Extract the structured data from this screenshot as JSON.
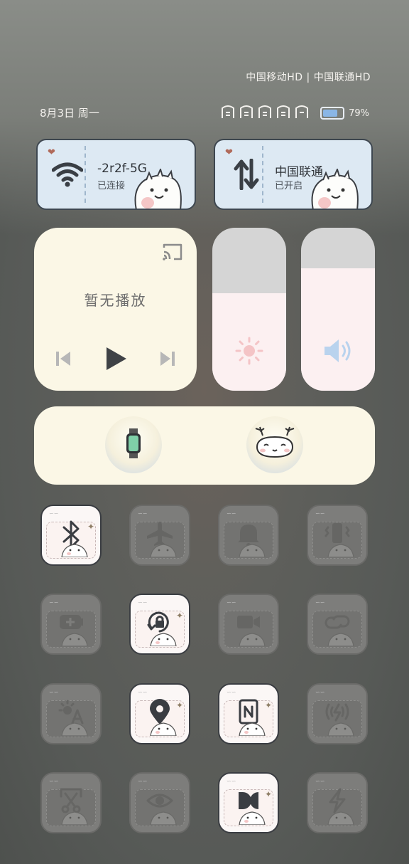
{
  "status": {
    "carriers": "中国移动HD | 中国联通HD",
    "date": "8月3日 周一",
    "battery": "79%",
    "battery_level": 0.79
  },
  "wifi_card": {
    "name": "-2r2f-5G",
    "state": "已连接",
    "icon": "wifi-icon"
  },
  "data_card": {
    "name": "中国联通",
    "state": "已开启",
    "icon": "mobile-data-icon"
  },
  "media": {
    "empty_text": "暂无播放"
  },
  "sliders": {
    "brightness_level": 0.6,
    "volume_level": 0.75
  },
  "devices": [
    {
      "name": "watch",
      "icon": "smartwatch-icon"
    },
    {
      "name": "companion",
      "icon": "cartoon-animal-icon"
    }
  ],
  "toggles": [
    {
      "icon": "bluetooth-icon",
      "on": true
    },
    {
      "icon": "airplane-icon",
      "on": false
    },
    {
      "icon": "bell-icon",
      "on": false
    },
    {
      "icon": "vibrate-icon",
      "on": false
    },
    {
      "icon": "battery-saver-icon",
      "on": false
    },
    {
      "icon": "rotation-lock-icon",
      "on": true
    },
    {
      "icon": "video-icon",
      "on": false
    },
    {
      "icon": "link-icon",
      "on": false
    },
    {
      "icon": "auto-brightness-icon",
      "on": false
    },
    {
      "icon": "location-icon",
      "on": true
    },
    {
      "icon": "nfc-icon",
      "on": true
    },
    {
      "icon": "wireless-charging-icon",
      "on": false
    },
    {
      "icon": "screenshot-scissors-icon",
      "on": false
    },
    {
      "icon": "eye-comfort-icon",
      "on": false
    },
    {
      "icon": "dark-mode-icon",
      "on": true
    },
    {
      "icon": "power-boost-icon",
      "on": false
    }
  ],
  "colors": {
    "card_cream": "#fbf7e6",
    "ticket_blue": "#dde9f3",
    "slider_pink": "#fcf0f1"
  }
}
